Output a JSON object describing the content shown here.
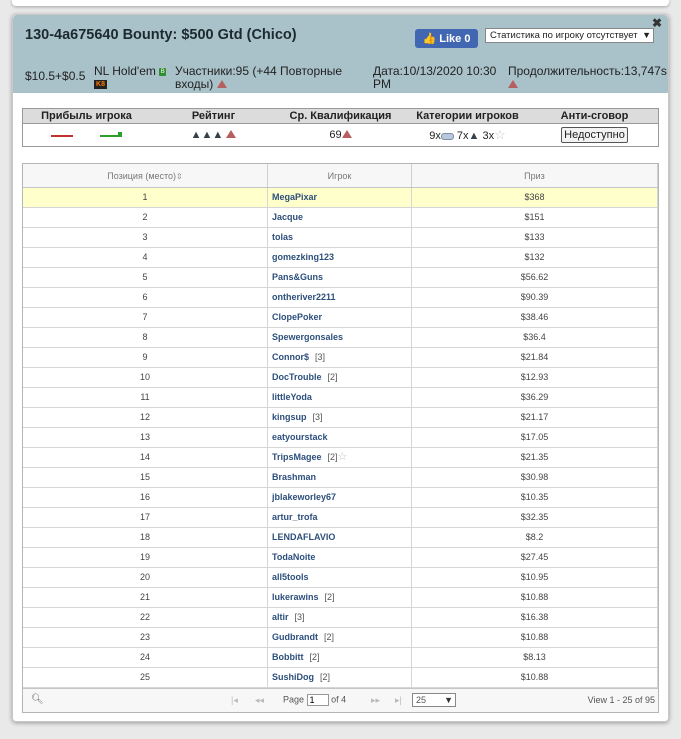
{
  "header": {
    "title": "130-4a675640 Bounty: $500 Gtd (Chico)",
    "fb_like_label": "Like 0",
    "stats_select": "Статистика по игроку отсутствует",
    "buyin": "$10.5+$0.5",
    "game_nl": "NL",
    "game_holdem": "Hold'em",
    "badge_b": "B",
    "badge_k": "K8",
    "participants_line1": "Участники:95 (+44 Повторные",
    "participants_line2": "входы)",
    "date_line1": "Дата:10/13/2020 10:30",
    "date_line2": "PM",
    "duration": "Продолжительность:13,747s"
  },
  "stats": {
    "headers": [
      "Прибыль игрока",
      "Рейтинг",
      "Ср. Квалификация",
      "Категории игроков",
      "Анти-сговор"
    ],
    "avg_qualification": "69",
    "categories": {
      "a_count": "9x",
      "b_count": "7x",
      "c_count": "3x"
    },
    "anti_collusion_button": "Недоступно"
  },
  "grid": {
    "columns": [
      "Позиция (место)",
      "Игрок",
      "Приз"
    ],
    "rows": [
      {
        "pos": "1",
        "player": "MegaPixar",
        "count": "",
        "prize": "$368"
      },
      {
        "pos": "2",
        "player": "Jacque",
        "count": "",
        "prize": "$151"
      },
      {
        "pos": "3",
        "player": "tolas",
        "count": "",
        "prize": "$133"
      },
      {
        "pos": "4",
        "player": "gomezking123",
        "count": "",
        "prize": "$132"
      },
      {
        "pos": "5",
        "player": "Pans&Guns",
        "count": "",
        "prize": "$56.62"
      },
      {
        "pos": "6",
        "player": "ontheriver2211",
        "count": "",
        "prize": "$90.39"
      },
      {
        "pos": "7",
        "player": "ClopePoker",
        "count": "",
        "prize": "$38.46"
      },
      {
        "pos": "8",
        "player": "Spewergonsales",
        "count": "",
        "prize": "$36.4"
      },
      {
        "pos": "9",
        "player": "Connor$",
        "count": "[3]",
        "prize": "$21.84"
      },
      {
        "pos": "10",
        "player": "DocTrouble",
        "count": "[2]",
        "prize": "$12.93"
      },
      {
        "pos": "11",
        "player": "littleYoda",
        "count": "",
        "prize": "$36.29"
      },
      {
        "pos": "12",
        "player": "kingsup",
        "count": "[3]",
        "prize": "$21.17"
      },
      {
        "pos": "13",
        "player": "eatyourstack",
        "count": "",
        "prize": "$17.05"
      },
      {
        "pos": "14",
        "player": "TripsMagee",
        "count": "[2]",
        "prize": "$21.35"
      },
      {
        "pos": "15",
        "player": "Brashman",
        "count": "",
        "prize": "$30.98"
      },
      {
        "pos": "16",
        "player": "jblakeworley67",
        "count": "",
        "prize": "$10.35"
      },
      {
        "pos": "17",
        "player": "artur_trofa",
        "count": "",
        "prize": "$32.35"
      },
      {
        "pos": "18",
        "player": "LENDAFLAVIO",
        "count": "",
        "prize": "$8.2"
      },
      {
        "pos": "19",
        "player": "TodaNoite",
        "count": "",
        "prize": "$27.45"
      },
      {
        "pos": "20",
        "player": "all5tools",
        "count": "",
        "prize": "$10.95"
      },
      {
        "pos": "21",
        "player": "lukerawins",
        "count": "[2]",
        "prize": "$10.88"
      },
      {
        "pos": "22",
        "player": "altir",
        "count": "[3]",
        "prize": "$16.38"
      },
      {
        "pos": "23",
        "player": "Gudbrandt",
        "count": "[2]",
        "prize": "$10.88"
      },
      {
        "pos": "24",
        "player": "Bobbitt",
        "count": "[2]",
        "prize": "$8.13"
      },
      {
        "pos": "25",
        "player": "SushiDog",
        "count": "[2]",
        "prize": "$10.88"
      }
    ]
  },
  "pager": {
    "page_label": "Page",
    "page_value": "1",
    "of_label": "of 4",
    "per_page": "25",
    "view_text": "View 1 - 25 of 95"
  },
  "colors": {
    "header_bg": "#a9c1c9",
    "link": "#2d4f7c",
    "highlight_row": "#ffffcc",
    "fb_blue": "#4267b2"
  }
}
